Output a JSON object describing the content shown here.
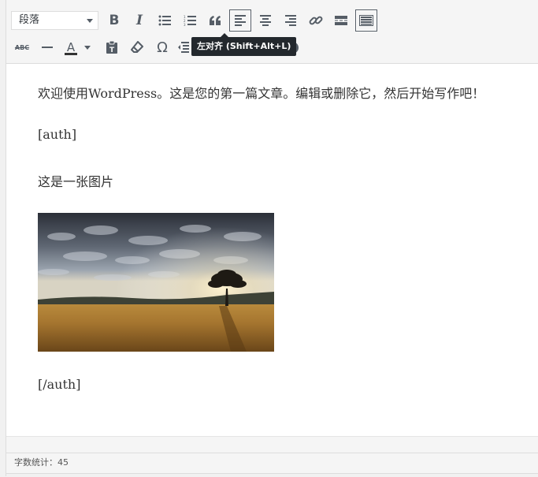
{
  "toolbar": {
    "format_select": {
      "value": "段落"
    },
    "tooltip": "左对齐 (Shift+Alt+L)",
    "row1": [
      "bold-icon",
      "italic-icon",
      "bulleted-list-icon",
      "numbered-list-icon",
      "blockquote-icon",
      "align-left-icon",
      "align-center-icon",
      "align-right-icon",
      "link-icon",
      "read-more-icon",
      "toolbar-toggle-icon"
    ],
    "row2": [
      "strikethrough-icon",
      "horizontal-line-icon",
      "text-color-icon",
      "paste-as-text-icon",
      "clear-formatting-icon",
      "special-character-icon",
      "outdent-icon",
      "help-icon"
    ],
    "strikethrough_label": "ABC",
    "text_color_label": "A",
    "bold_label": "B",
    "italic_label": "I",
    "omega_label": "Ω",
    "help_label": "?",
    "active_item": "align-left"
  },
  "content": {
    "paragraphs": [
      "欢迎使用WordPress。这是您的第一篇文章。编辑或删除它，然后开始写作吧！",
      "[auth]",
      "这是一张图片",
      "[/auth]"
    ]
  },
  "status": {
    "word_count": "字数统计：45"
  }
}
